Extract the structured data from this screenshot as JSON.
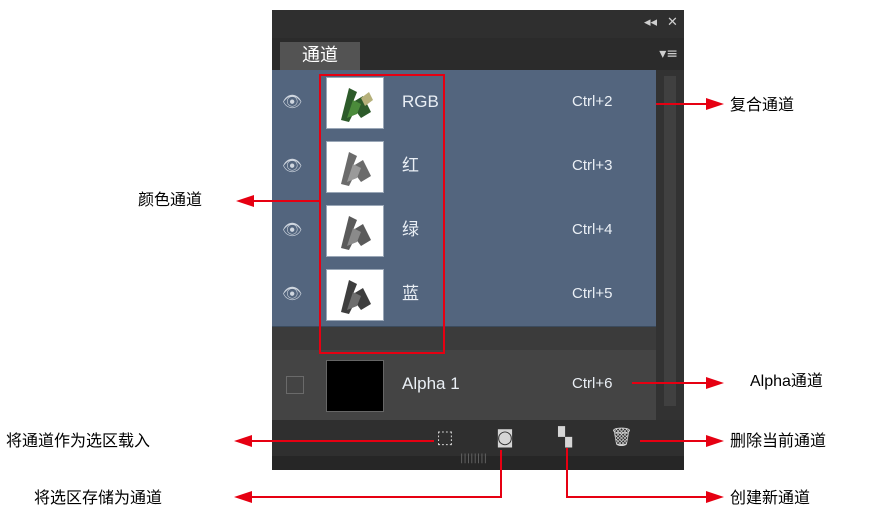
{
  "panel": {
    "tab_label": "通道",
    "collapse_icon": "◂◂",
    "close_icon": "✕",
    "menu_icon": "▾≡",
    "status_grip": "||||||||"
  },
  "channels": [
    {
      "name": "RGB",
      "shortcut": "Ctrl+2",
      "visible": true,
      "selected": true,
      "thumb": "color"
    },
    {
      "name": "红",
      "shortcut": "Ctrl+3",
      "visible": true,
      "selected": true,
      "thumb": "gray"
    },
    {
      "name": "绿",
      "shortcut": "Ctrl+4",
      "visible": true,
      "selected": true,
      "thumb": "gray"
    },
    {
      "name": "蓝",
      "shortcut": "Ctrl+5",
      "visible": true,
      "selected": true,
      "thumb": "gray"
    },
    {
      "name": "Alpha 1",
      "shortcut": "Ctrl+6",
      "visible": false,
      "selected": false,
      "thumb": "black"
    }
  ],
  "bottom_icons": {
    "load_selection": "load-selection-icon",
    "save_selection": "save-selection-icon",
    "new_channel": "new-channel-icon",
    "delete_channel": "trash-icon"
  },
  "annotations": {
    "composite": "复合通道",
    "color_channels": "颜色通道",
    "alpha": "Alpha通道",
    "load_as_selection": "将通道作为选区载入",
    "delete_current": "删除当前通道",
    "save_selection": "将选区存储为通道",
    "create_new": "创建新通道"
  },
  "colors": {
    "accent_red": "#e60012",
    "selected_row": "#53657e"
  }
}
